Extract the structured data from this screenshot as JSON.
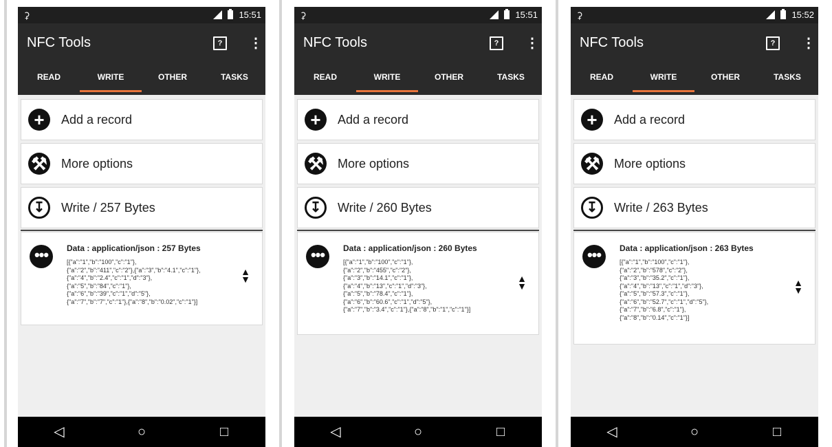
{
  "phones": [
    {
      "statusbar": {
        "time": "15:51",
        "notif_icon": "incognito-icon"
      },
      "appbar": {
        "title": "NFC Tools",
        "help_icon": "?",
        "menu_icon": "⋮"
      },
      "tabs": [
        "READ",
        "WRITE",
        "OTHER",
        "TASKS"
      ],
      "active_tab": "WRITE",
      "actions": {
        "add": "Add a record",
        "options": "More options",
        "write": "Write / 257 Bytes"
      },
      "record": {
        "title": "Data : application/json : 257 Bytes",
        "body": "[{\"a\":\"1\",\"b\":\"100\",\"c\":\"1\"},\n{\"a\":\"2\",\"b\":\"411\",\"c\":\"2\"},{\"a\":\"3\",\"b\":\"4.1\",\"c\":\"1\"},\n{\"a\":\"4\",\"b\":\"2.4\",\"c\":\"1\",\"d\":\"3\"},\n{\"a\":\"5\",\"b\":\"84\",\"c\":\"1\"},\n{\"a\":\"6\",\"b\":\"39\",\"c\":\"1\",\"d\":\"5\"},\n{\"a\":\"7\",\"b\":\"7\",\"c\":\"1\"},{\"a\":\"8\",\"b\":\"0.02\",\"c\":\"1\"}]"
      }
    },
    {
      "statusbar": {
        "time": "15:51",
        "notif_icon": "incognito-icon"
      },
      "appbar": {
        "title": "NFC Tools",
        "help_icon": "?",
        "menu_icon": "⋮"
      },
      "tabs": [
        "READ",
        "WRITE",
        "OTHER",
        "TASKS"
      ],
      "active_tab": "WRITE",
      "actions": {
        "add": "Add a record",
        "options": "More options",
        "write": "Write / 260 Bytes"
      },
      "record": {
        "title": "Data : application/json : 260 Bytes",
        "body": "[{\"a\":\"1\",\"b\":\"100\",\"c\":\"1\"},\n{\"a\":\"2\",\"b\":\"455\",\"c\":\"2\"},\n{\"a\":\"3\",\"b\":\"14.1\",\"c\":\"1\"},\n{\"a\":\"4\",\"b\":\"13\",\"c\":\"1\",\"d\":\"3\"},\n{\"a\":\"5\",\"b\":\"78.4\",\"c\":\"1\"},\n{\"a\":\"6\",\"b\":\"60.6\",\"c\":\"1\",\"d\":\"5\"},\n{\"a\":\"7\",\"b\":\"3.4\",\"c\":\"1\"},{\"a\":\"8\",\"b\":\"1\",\"c\":\"1\"}]"
      }
    },
    {
      "statusbar": {
        "time": "15:52",
        "notif_icon": "incognito-icon"
      },
      "appbar": {
        "title": "NFC Tools",
        "help_icon": "?",
        "menu_icon": "⋮"
      },
      "tabs": [
        "READ",
        "WRITE",
        "OTHER",
        "TASKS"
      ],
      "active_tab": "WRITE",
      "actions": {
        "add": "Add a record",
        "options": "More options",
        "write": "Write / 263 Bytes"
      },
      "record": {
        "title": "Data : application/json : 263 Bytes",
        "body": "[{\"a\":\"1\",\"b\":\"100\",\"c\":\"1\"},\n{\"a\":\"2\",\"b\":\"578\",\"c\":\"2\"},\n{\"a\":\"3\",\"b\":\"35.2\",\"c\":\"1\"},\n{\"a\":\"4\",\"b\":\"13\",\"c\":\"1\",\"d\":\"3\"},\n{\"a\":\"5\",\"b\":\"57.3\",\"c\":\"1\"},\n{\"a\":\"6\",\"b\":\"52.7\",\"c\":\"1\",\"d\":\"5\"},\n{\"a\":\"7\",\"b\":\"6.8\",\"c\":\"1\"},\n{\"a\":\"8\",\"b\":\"0.14\",\"c\":\"1\"}]"
      }
    }
  ],
  "navbar": {
    "back": "◁",
    "home": "○",
    "recents": "□"
  },
  "colors": {
    "appbar": "#2a2a2a",
    "statusbar": "#1f1f1f",
    "tab_indicator": "#e8743b",
    "background": "#efefef"
  }
}
